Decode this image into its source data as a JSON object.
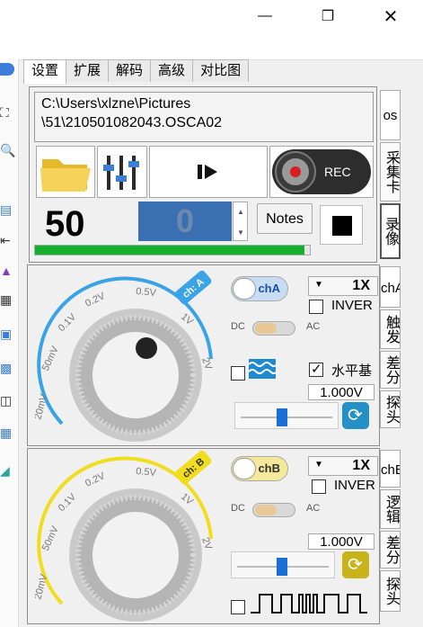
{
  "tabs": [
    {
      "label": "设置",
      "active": true
    },
    {
      "label": "扩展",
      "active": false
    },
    {
      "label": "解码",
      "active": false
    },
    {
      "label": "高级",
      "active": false
    },
    {
      "label": "对比图",
      "active": false
    }
  ],
  "file_path": {
    "line1": "C:\\Users\\xlzne\\Pictures",
    "line2": "\\51\\210501082043.OSCA02"
  },
  "rec_label": "REC",
  "counter": "50",
  "spin_value": "0",
  "notes_label": "Notes",
  "progress_fraction": 0.98,
  "right_tabs_top": [
    "os",
    "采集卡",
    "录像"
  ],
  "right_tabs_a": [
    "chA",
    "触发",
    "差分",
    "探头"
  ],
  "right_tabs_b": [
    "chE",
    "逻辑",
    "差分",
    "探头"
  ],
  "channel_a": {
    "badge": "ch: A",
    "button": "chA",
    "scale": "1X",
    "invert": "INVER",
    "dc": "DC",
    "ac": "AC",
    "horizontal": "水平基",
    "value": "1.000V",
    "ticks": [
      "20mV",
      "50mV",
      "0.1V",
      "0.2V",
      "0.5V",
      "1V",
      "2V"
    ],
    "color": "#3aa3e6"
  },
  "channel_b": {
    "badge": "ch: B",
    "button": "chB",
    "scale": "1X",
    "invert": "INVER",
    "dc": "DC",
    "ac": "AC",
    "value": "1.000V",
    "ticks": [
      "20mV",
      "50mV",
      "0.1V",
      "0.2V",
      "0.5V",
      "1V",
      "2V"
    ],
    "color": "#f0dd20"
  }
}
